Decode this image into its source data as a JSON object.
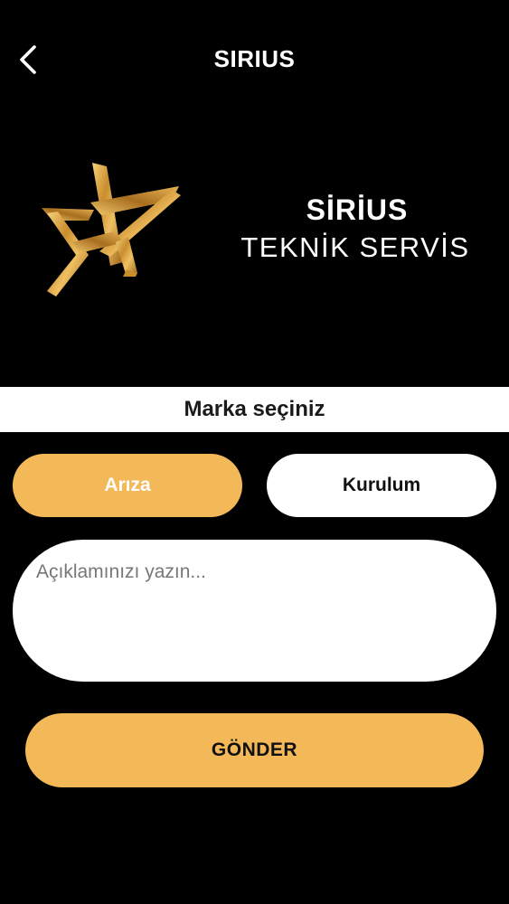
{
  "header": {
    "title": "SIRIUS",
    "back_icon": "chevron-left-icon"
  },
  "brand": {
    "logo_icon": "gold-star-logo",
    "name": "SİRİUS",
    "subtitle": "TEKNİK SERVİS"
  },
  "brand_select": {
    "label": "Marka seçiniz"
  },
  "type_options": {
    "ariza": "Arıza",
    "kurulum": "Kurulum",
    "selected": "Arıza"
  },
  "description": {
    "placeholder": "Açıklamınızı yazın...",
    "value": ""
  },
  "submit": {
    "label": "GÖNDER"
  },
  "colors": {
    "background": "#000000",
    "accent": "#f3b858",
    "surface": "#ffffff"
  }
}
